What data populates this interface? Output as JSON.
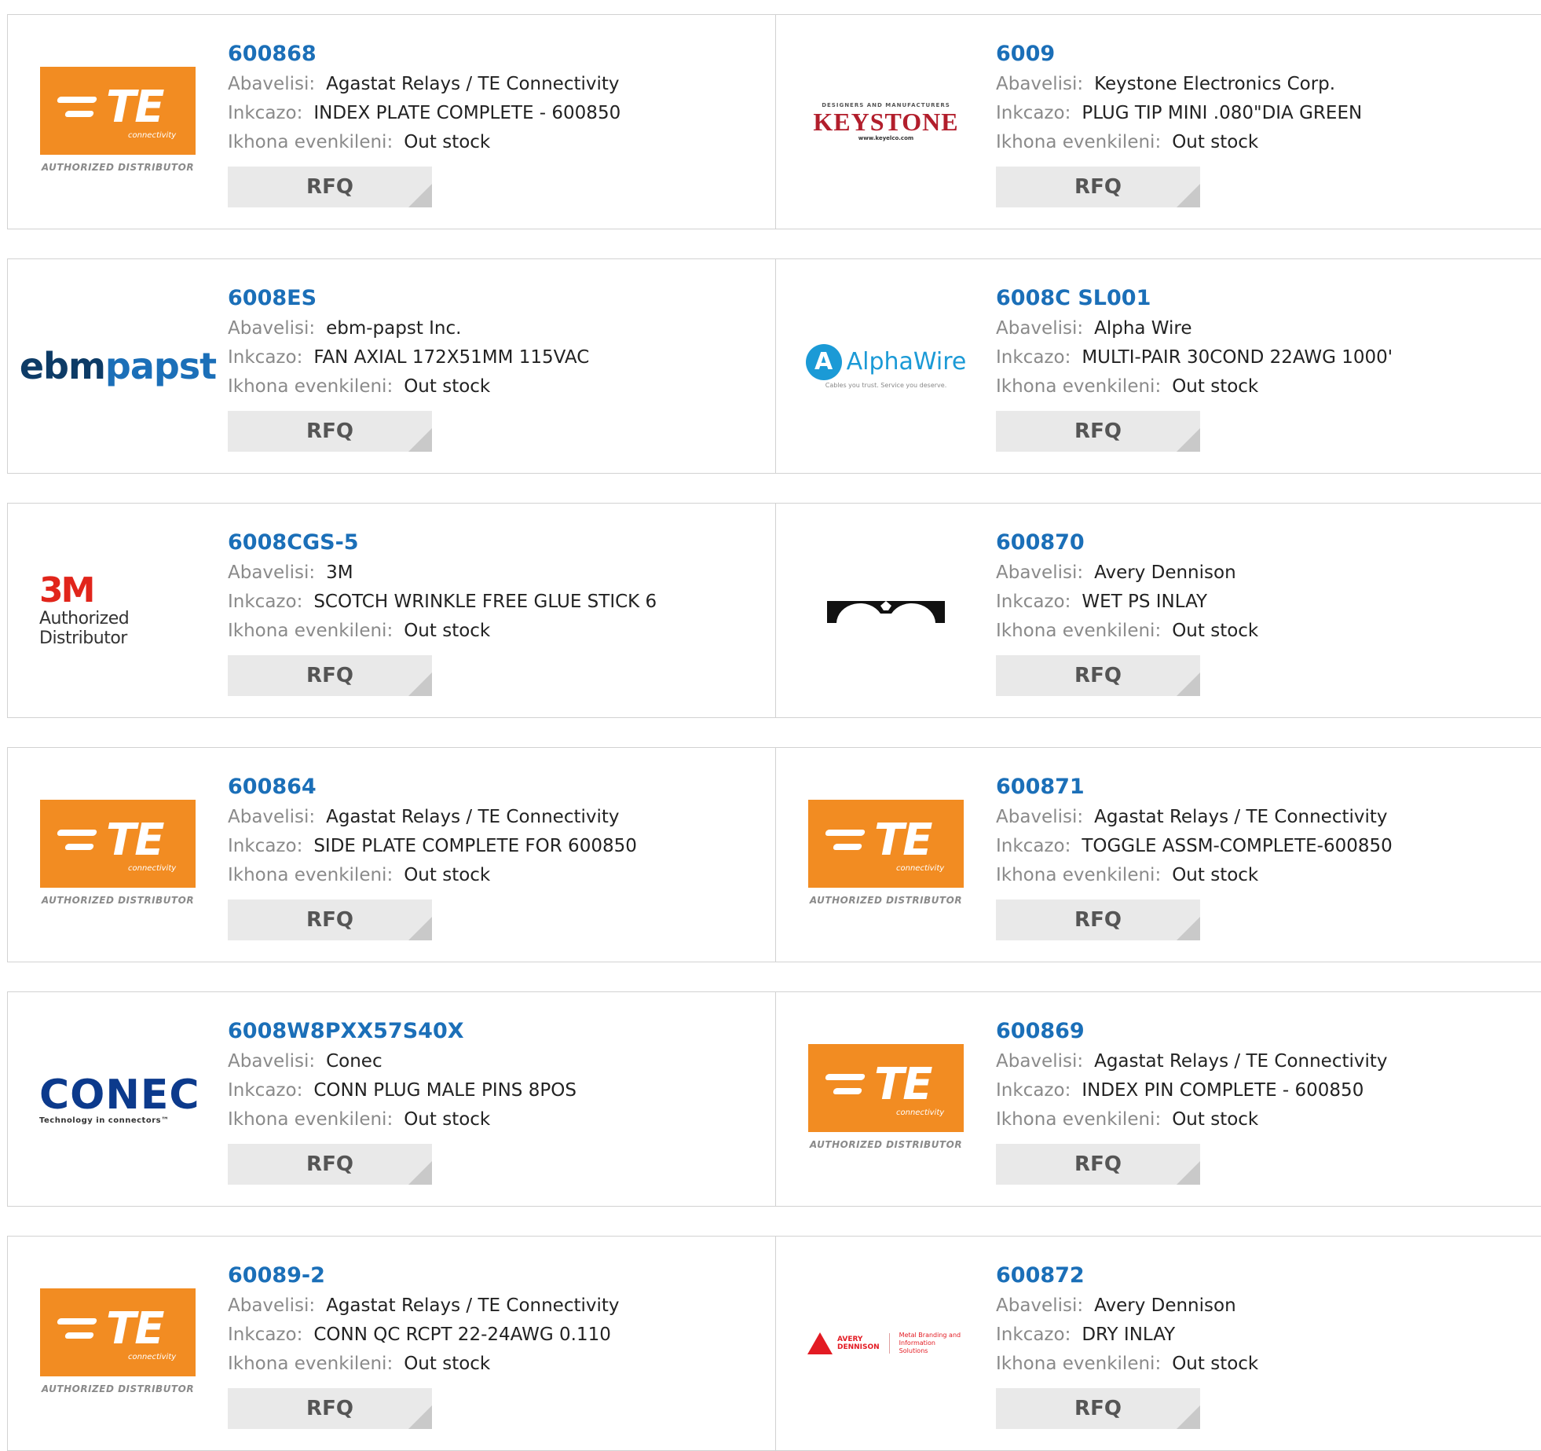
{
  "labels": {
    "manufacturer": "Abavelisi:",
    "description": "Inkcazo:",
    "stock": "Ikhona evenkileni:",
    "rfq": "RFQ"
  },
  "logos": {
    "te": {
      "main": "TE",
      "sub": "connectivity",
      "auth": "AUTHORIZED DISTRIBUTOR"
    },
    "keystone": {
      "top": "DESIGNERS AND MANUFACTURERS",
      "main": "KEYSTONE",
      "sub": "www.keyelco.com"
    },
    "ebm": {
      "part1": "ebm",
      "part2": "papst"
    },
    "alpha": {
      "letter": "A",
      "name": "AlphaWire",
      "tag": "Cables you trust. Service you deserve."
    },
    "threem": {
      "main": "3M",
      "sub": "Authorized Distributor"
    },
    "conec": {
      "main": "CONEC",
      "sub": "Technology in connectors™"
    },
    "avery": {
      "name1": "AVERY",
      "name2": "DENNISON",
      "desc1": "Metal Branding and",
      "desc2": "Information Solutions"
    }
  },
  "products": [
    {
      "part": "600868",
      "manufacturer": "Agastat Relays / TE Connectivity",
      "description": "INDEX PLATE COMPLETE - 600850",
      "stock": "Out stock",
      "logo": "te"
    },
    {
      "part": "6009",
      "manufacturer": "Keystone Electronics Corp.",
      "description": "PLUG TIP MINI .080\"DIA GREEN",
      "stock": "Out stock",
      "logo": "keystone"
    },
    {
      "part": "6008ES",
      "manufacturer": "ebm-papst Inc.",
      "description": "FAN AXIAL 172X51MM 115VAC",
      "stock": "Out stock",
      "logo": "ebm"
    },
    {
      "part": "6008C SL001",
      "manufacturer": "Alpha Wire",
      "description": "MULTI-PAIR 30COND 22AWG 1000'",
      "stock": "Out stock",
      "logo": "alpha"
    },
    {
      "part": "6008CGS-5",
      "manufacturer": "3M",
      "description": "SCOTCH WRINKLE FREE GLUE STICK 6",
      "stock": "Out stock",
      "logo": "threem"
    },
    {
      "part": "600870",
      "manufacturer": "Avery Dennison",
      "description": "WET PS INLAY",
      "stock": "Out stock",
      "logo": "avery-arch"
    },
    {
      "part": "600864",
      "manufacturer": "Agastat Relays / TE Connectivity",
      "description": "SIDE PLATE COMPLETE FOR 600850",
      "stock": "Out stock",
      "logo": "te"
    },
    {
      "part": "600871",
      "manufacturer": "Agastat Relays / TE Connectivity",
      "description": "TOGGLE ASSM-COMPLETE-600850",
      "stock": "Out stock",
      "logo": "te"
    },
    {
      "part": "6008W8PXX57S40X",
      "manufacturer": "Conec",
      "description": "CONN PLUG MALE PINS 8POS",
      "stock": "Out stock",
      "logo": "conec"
    },
    {
      "part": "600869",
      "manufacturer": "Agastat Relays / TE Connectivity",
      "description": "INDEX PIN COMPLETE - 600850",
      "stock": "Out stock",
      "logo": "te"
    },
    {
      "part": "60089-2",
      "manufacturer": "Agastat Relays / TE Connectivity",
      "description": "CONN QC RCPT 22-24AWG 0.110",
      "stock": "Out stock",
      "logo": "te"
    },
    {
      "part": "600872",
      "manufacturer": "Avery Dennison",
      "description": "DRY INLAY",
      "stock": "Out stock",
      "logo": "avery-small"
    }
  ]
}
